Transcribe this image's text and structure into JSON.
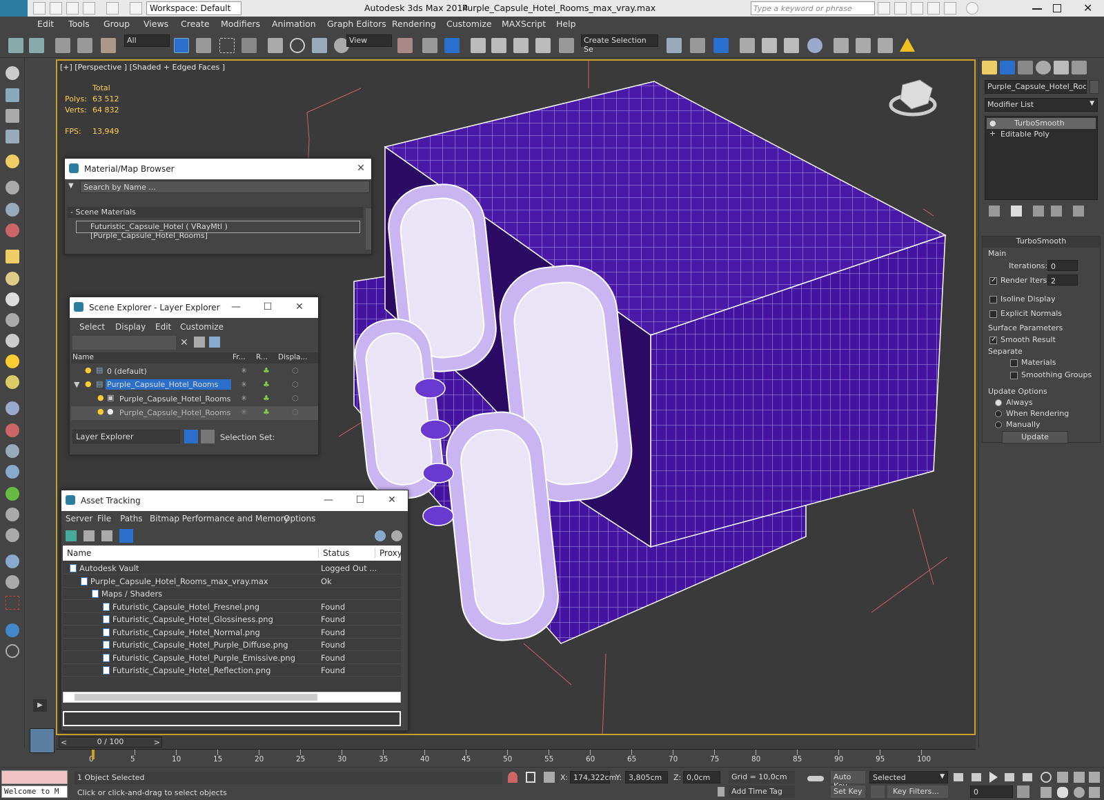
{
  "window": {
    "app_title": "Autodesk 3ds Max  2014",
    "file_title": "Purple_Capsule_Hotel_Rooms_max_vray.max",
    "workspace": "Workspace: Default",
    "search_placeholder": "Type a keyword or phrase"
  },
  "menu": [
    "Edit",
    "Tools",
    "Group",
    "Views",
    "Create",
    "Modifiers",
    "Animation",
    "Graph Editors",
    "Rendering",
    "Customize",
    "MAXScript",
    "Help"
  ],
  "toolbar": {
    "filter": "All",
    "refcoord": "View",
    "selection_set_placeholder": "Create Selection Se"
  },
  "viewport": {
    "label": "[+] [Perspective ] [Shaded + Edged Faces ]",
    "stats_header": "Total",
    "polys_label": "Polys:",
    "polys_value": "63 512",
    "verts_label": "Verts:",
    "verts_value": "64 832",
    "fps_label": "FPS:",
    "fps_value": "13,949"
  },
  "material_browser": {
    "title": "Material/Map Browser",
    "search": "Search by Name ...",
    "section": "- Scene Materials",
    "item": "Futuristic_Capsule_Hotel ( VRayMtl ) [Purple_Capsule_Hotel_Rooms]"
  },
  "scene_explorer": {
    "title": "Scene Explorer - Layer Explorer",
    "menu": [
      "Select",
      "Display",
      "Edit",
      "Customize"
    ],
    "columns": [
      "Name",
      "Fr...",
      "R...",
      "Displa..."
    ],
    "rows": [
      "0 (default)",
      "Purple_Capsule_Hotel_Rooms",
      "Purple_Capsule_Hotel_Rooms",
      "Purple_Capsule_Hotel_Rooms"
    ],
    "dropdown": "Layer Explorer",
    "selection_set": "Selection Set:"
  },
  "asset_tracking": {
    "title": "Asset Tracking",
    "menu": [
      "Server",
      "File",
      "Paths",
      "Bitmap Performance and Memory",
      "Options"
    ],
    "columns": [
      "Name",
      "Status",
      "Proxy"
    ],
    "rows": [
      {
        "name": "Autodesk Vault",
        "status": "Logged Out ..."
      },
      {
        "name": "Purple_Capsule_Hotel_Rooms_max_vray.max",
        "status": "Ok"
      },
      {
        "name": "Maps / Shaders",
        "status": ""
      },
      {
        "name": "Futuristic_Capsule_Hotel_Fresnel.png",
        "status": "Found"
      },
      {
        "name": "Futuristic_Capsule_Hotel_Glossiness.png",
        "status": "Found"
      },
      {
        "name": "Futuristic_Capsule_Hotel_Normal.png",
        "status": "Found"
      },
      {
        "name": "Futuristic_Capsule_Hotel_Purple_Diffuse.png",
        "status": "Found"
      },
      {
        "name": "Futuristic_Capsule_Hotel_Purple_Emissive.png",
        "status": "Found"
      },
      {
        "name": "Futuristic_Capsule_Hotel_Reflection.png",
        "status": "Found"
      }
    ]
  },
  "command_panel": {
    "object_name": "Purple_Capsule_Hotel_Rooms",
    "modifier_list": "Modifier List",
    "stack": [
      "TurboSmooth",
      "Editable Poly"
    ],
    "rollout": "TurboSmooth",
    "main": "Main",
    "iterations_label": "Iterations:",
    "iterations_value": "0",
    "render_iters_label": "Render Iters:",
    "render_iters_value": "2",
    "isoline": "Isoline Display",
    "explicit": "Explicit Normals",
    "surface": "Surface Parameters",
    "smooth_result": "Smooth Result",
    "separate": "Separate",
    "materials": "Materials",
    "smoothing_groups": "Smoothing Groups",
    "update_options": "Update Options",
    "always": "Always",
    "when_rendering": "When Rendering",
    "manually": "Manually",
    "update": "Update"
  },
  "timeline": {
    "frame": "0 / 100",
    "ticks": [
      "0",
      "5",
      "10",
      "15",
      "20",
      "25",
      "30",
      "35",
      "40",
      "45",
      "50",
      "55",
      "60",
      "65",
      "70",
      "75",
      "80",
      "85",
      "90",
      "95",
      "100"
    ]
  },
  "status": {
    "maxscript": "Welcome to M",
    "selected": "1 Object Selected",
    "prompt": "Click or click-and-drag to select objects",
    "x_label": "X:",
    "x_value": "174,322cm",
    "y_label": "Y:",
    "y_value": "3,805cm",
    "z_label": "Z:",
    "z_value": "0,0cm",
    "grid": "Grid = 10,0cm",
    "add_time_tag": "Add Time Tag",
    "auto_key": "Auto Key",
    "set_key": "Set Key",
    "key_mode": "Selected",
    "key_filters": "Key Filters...",
    "frame_field": "0"
  },
  "colors": {
    "purple": "#4b19a8",
    "viewport_border": "#c9a227",
    "selection_blue": "#2a6fcc"
  }
}
